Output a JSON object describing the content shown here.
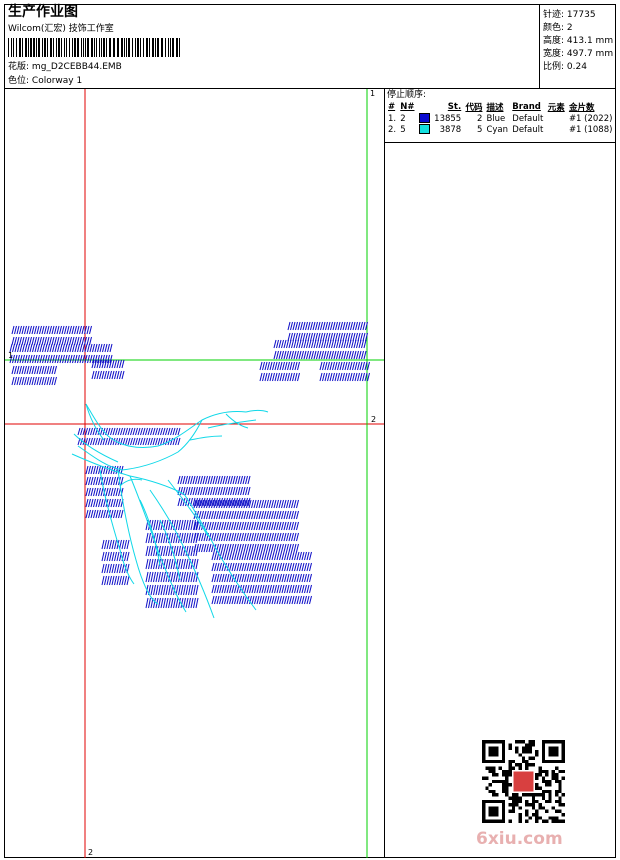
{
  "header": {
    "title": "生产作业图",
    "company": "Wilcom(汇宏) 技饰工作室",
    "design_label": "花版:",
    "design_file": "mg_D2CEBB44.EMB",
    "colorway_label": "色位:",
    "colorway": "Colorway 1"
  },
  "info": {
    "stitches_label": "针迹:",
    "stitches": "17735",
    "colors_label": "颜色:",
    "colors": "2",
    "height_label": "高度:",
    "height": "413.1 mm",
    "width_label": "宽度:",
    "width": "497.7 mm",
    "scale_label": "比例:",
    "scale": "0.24"
  },
  "stop_sequence": {
    "title": "停止顺序:",
    "headers": [
      "#",
      "N#",
      "St.",
      "代码",
      "描述",
      "Brand",
      "元素",
      "金片数"
    ],
    "rows": [
      {
        "idx": "1.",
        "n": "2",
        "color": "#0a0ad0",
        "st": "13855",
        "code": "2",
        "desc": "Blue",
        "brand": "Default",
        "sequin": "#1 (2022)"
      },
      {
        "idx": "2.",
        "n": "5",
        "color": "#13e0e0",
        "st": "3878",
        "code": "5",
        "desc": "Cyan",
        "brand": "Default",
        "sequin": "#1 (1088)"
      }
    ]
  },
  "markers": {
    "v1_top": "1",
    "h1_left": "1",
    "h2_right": "2",
    "v2_bottom": "2"
  },
  "watermark": "6xiu.com",
  "colors": {
    "guide_red": "#e00000",
    "guide_green": "#00d000",
    "thread_blue": "#1010c8",
    "thread_cyan": "#10d8e8"
  }
}
